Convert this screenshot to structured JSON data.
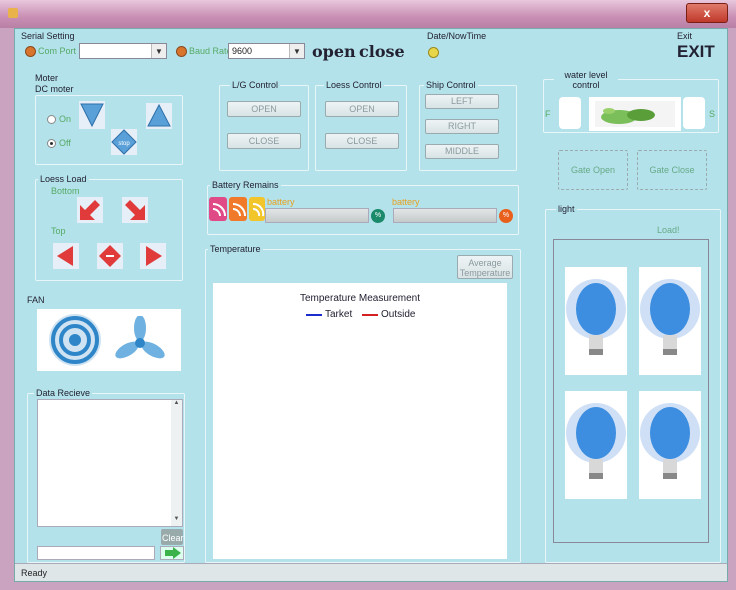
{
  "window": {
    "close_glyph": "x"
  },
  "serial": {
    "group_title": "Serial Setting",
    "com_port_label": "Com Port",
    "com_port_value": "",
    "baud_label": "Baud Rate",
    "baud_value": "9600",
    "open_label": "open",
    "close_label": "close"
  },
  "datetime": {
    "group_title": "Date/NowTime"
  },
  "exit": {
    "group_title": "Exit",
    "button_label": "EXIT"
  },
  "motor": {
    "group_title": "Moter",
    "dc_title": "DC moter",
    "on_label": "On",
    "off_label": "Off",
    "selected": "Off",
    "stop_label": "stop"
  },
  "loess_load": {
    "group_title": "Loess Load",
    "bottom_label": "Bottom",
    "top_label": "Top"
  },
  "fan": {
    "group_title": "FAN"
  },
  "data_receive": {
    "group_title": "Data Recieve",
    "clear_label": "Clear"
  },
  "lg_control": {
    "group_title": "L/G Control",
    "open_label": "OPEN",
    "close_label": "CLOSE"
  },
  "loess_control": {
    "group_title": "Loess Control",
    "open_label": "OPEN",
    "close_label": "CLOSE"
  },
  "ship_control": {
    "group_title": "Ship Control",
    "left_label": "LEFT",
    "right_label": "RIGHT",
    "middle_label": "MIDDLE"
  },
  "battery": {
    "group_title": "Battery Remains",
    "battery1_label": "battery",
    "battery2_label": "battery",
    "percent_symbol": "%"
  },
  "temperature": {
    "group_title": "Temperature",
    "average_label": "Average Temperature",
    "chart_title": "Temperature Measurement",
    "legend_1": "Tarket",
    "legend_2": "Outside"
  },
  "water": {
    "group_title": "water level control",
    "f_label": "F",
    "s_label": "S",
    "gate_open_label": "Gate Open",
    "gate_close_label": "Gate Close"
  },
  "light": {
    "group_title": "light",
    "load_label": "Load!"
  },
  "status": {
    "text": "Ready"
  },
  "colors": {
    "client_bg": "#b4e2ea",
    "led_orange": "#d9742c",
    "led_yellow": "#e8d64a",
    "battery_teal": "#1a8a6b",
    "battery_orange": "#e8601c",
    "legend_blue": "#1a2ccc",
    "legend_red": "#d42020"
  }
}
